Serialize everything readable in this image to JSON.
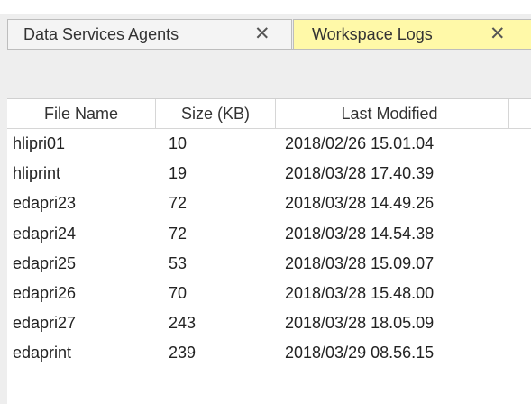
{
  "tabs": [
    {
      "label": "Data Services Agents",
      "close_icon": "close-icon",
      "active": false
    },
    {
      "label": "Workspace Logs",
      "close_icon": "close-icon",
      "active": true
    }
  ],
  "close_glyph": "✕",
  "colors": {
    "active_tab": "#fff9a8",
    "inactive_tab": "#f4f4f4",
    "toolbar_bg": "#eeeeee"
  },
  "table": {
    "columns": [
      "File Name",
      "Size (KB)",
      "Last Modified"
    ],
    "rows": [
      {
        "name": "hlipri01",
        "size": "10",
        "modified": "2018/02/26 15.01.04"
      },
      {
        "name": "hliprint",
        "size": "19",
        "modified": "2018/03/28 17.40.39"
      },
      {
        "name": "edapri23",
        "size": "72",
        "modified": "2018/03/28 14.49.26"
      },
      {
        "name": "edapri24",
        "size": "72",
        "modified": "2018/03/28 14.54.38"
      },
      {
        "name": "edapri25",
        "size": "53",
        "modified": "2018/03/28 15.09.07"
      },
      {
        "name": "edapri26",
        "size": "70",
        "modified": "2018/03/28 15.48.00"
      },
      {
        "name": "edapri27",
        "size": "243",
        "modified": "2018/03/28 18.05.09"
      },
      {
        "name": "edaprint",
        "size": "239",
        "modified": "2018/03/29 08.56.15"
      }
    ]
  }
}
